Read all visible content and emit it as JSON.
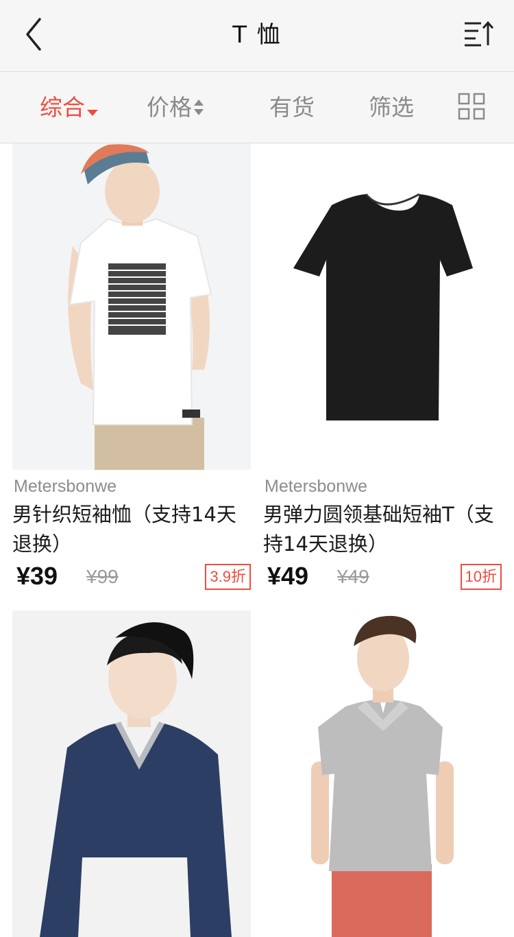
{
  "nav": {
    "title": "T 恤"
  },
  "filters": {
    "general": "综合",
    "price": "价格",
    "instock": "有货",
    "filter": "筛选"
  },
  "colors": {
    "accent": "#f04b3f"
  },
  "products": [
    {
      "brand": "Metersbonwe",
      "name": "男针织短袖恤（支持14天退换）",
      "price": "¥39",
      "old_price": "¥99",
      "discount": "3.9折"
    },
    {
      "brand": "Metersbonwe",
      "name": "男弹力圆领基础短袖T（支持14天退换）",
      "price": "¥49",
      "old_price": "¥49",
      "discount": "10折"
    },
    {
      "brand": "",
      "name": "",
      "price": "",
      "old_price": "",
      "discount": ""
    },
    {
      "brand": "",
      "name": "",
      "price": "",
      "old_price": "",
      "discount": ""
    }
  ]
}
